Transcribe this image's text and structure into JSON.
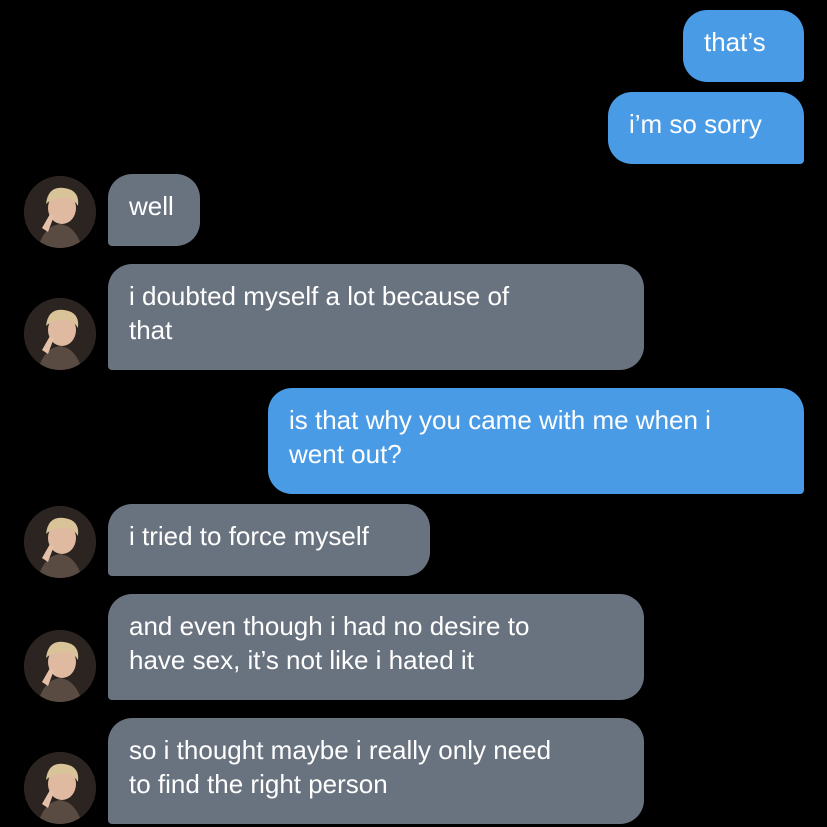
{
  "colors": {
    "background": "#000000",
    "outgoing_bubble": "#4a9be6",
    "incoming_bubble": "#69737f",
    "text": "#ffffff"
  },
  "messages": [
    {
      "direction": "outgoing",
      "text": "that’s"
    },
    {
      "direction": "outgoing",
      "text": "i’m so sorry"
    },
    {
      "direction": "incoming",
      "avatar": "contact-avatar",
      "text": "well"
    },
    {
      "direction": "incoming",
      "avatar": "contact-avatar",
      "text": "i doubted myself a lot because of\nthat"
    },
    {
      "direction": "outgoing",
      "text": "is that why you came with me when i\nwent out?"
    },
    {
      "direction": "incoming",
      "avatar": "contact-avatar",
      "text": "i tried to force myself"
    },
    {
      "direction": "incoming",
      "avatar": "contact-avatar",
      "text": "and even though i had no desire to\nhave sex, it’s not like i hated it"
    },
    {
      "direction": "incoming",
      "avatar": "contact-avatar",
      "text": "so i thought maybe i really only need\nto find the right person"
    }
  ]
}
